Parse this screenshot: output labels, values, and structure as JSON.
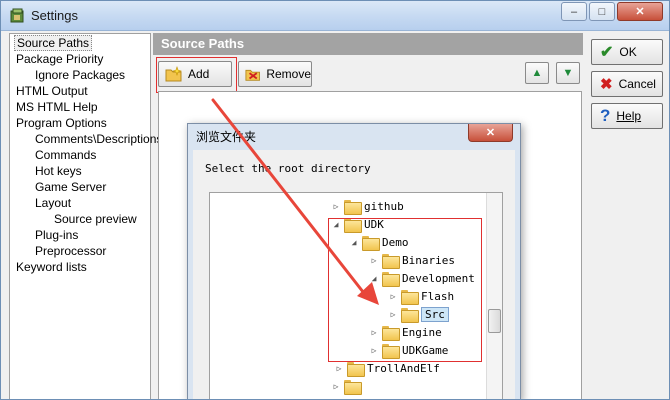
{
  "window": {
    "title": "Settings",
    "min_label": "–",
    "max_label": "□",
    "close_label": "✕"
  },
  "sidebar": {
    "items": [
      {
        "label": "Source Paths",
        "indent": 0,
        "selected": true
      },
      {
        "label": "Package Priority",
        "indent": 0
      },
      {
        "label": "Ignore Packages",
        "indent": 1
      },
      {
        "label": "HTML Output",
        "indent": 0
      },
      {
        "label": "MS HTML Help",
        "indent": 0
      },
      {
        "label": "Program Options",
        "indent": 0
      },
      {
        "label": "Comments\\Descriptions",
        "indent": 1
      },
      {
        "label": "Commands",
        "indent": 1
      },
      {
        "label": "Hot keys",
        "indent": 1
      },
      {
        "label": "Game Server",
        "indent": 1
      },
      {
        "label": "Layout",
        "indent": 1
      },
      {
        "label": "Source preview",
        "indent": 2
      },
      {
        "label": "Plug-ins",
        "indent": 1
      },
      {
        "label": "Preprocessor",
        "indent": 1
      },
      {
        "label": "Keyword lists",
        "indent": 0
      }
    ]
  },
  "section": {
    "title": "Source Paths"
  },
  "toolbar": {
    "add_label": "Add",
    "remove_label": "Remove",
    "up_label": "▲",
    "down_label": "▼"
  },
  "actions": {
    "ok_label": "OK",
    "cancel_label": "Cancel",
    "help_label": "Help"
  },
  "dialog": {
    "title": "浏览文件夹",
    "close_label": "✕",
    "prompt": "Select the root directory",
    "nodes": [
      {
        "label": "github",
        "level": 0,
        "expander": "▷"
      },
      {
        "label": "UDK",
        "level": 0,
        "expander": "◢"
      },
      {
        "label": "Demo",
        "level": 1,
        "expander": "◢"
      },
      {
        "label": "Binaries",
        "level": 2,
        "expander": "▷"
      },
      {
        "label": "Development",
        "level": 2,
        "expander": "◢"
      },
      {
        "label": "Flash",
        "level": 3,
        "expander": "▷"
      },
      {
        "label": "Src",
        "level": 3,
        "expander": "▷",
        "selected": true
      },
      {
        "label": "Engine",
        "level": 2,
        "expander": "▷"
      },
      {
        "label": "UDKGame",
        "level": 2,
        "expander": "▷"
      },
      {
        "label": "TrollAndElf",
        "level": -1,
        "expander": "▷"
      },
      {
        "label": "",
        "level": -2,
        "expander": "▷"
      }
    ]
  },
  "colors": {
    "annotation": "#e03030",
    "arrow": "#e8463a"
  }
}
